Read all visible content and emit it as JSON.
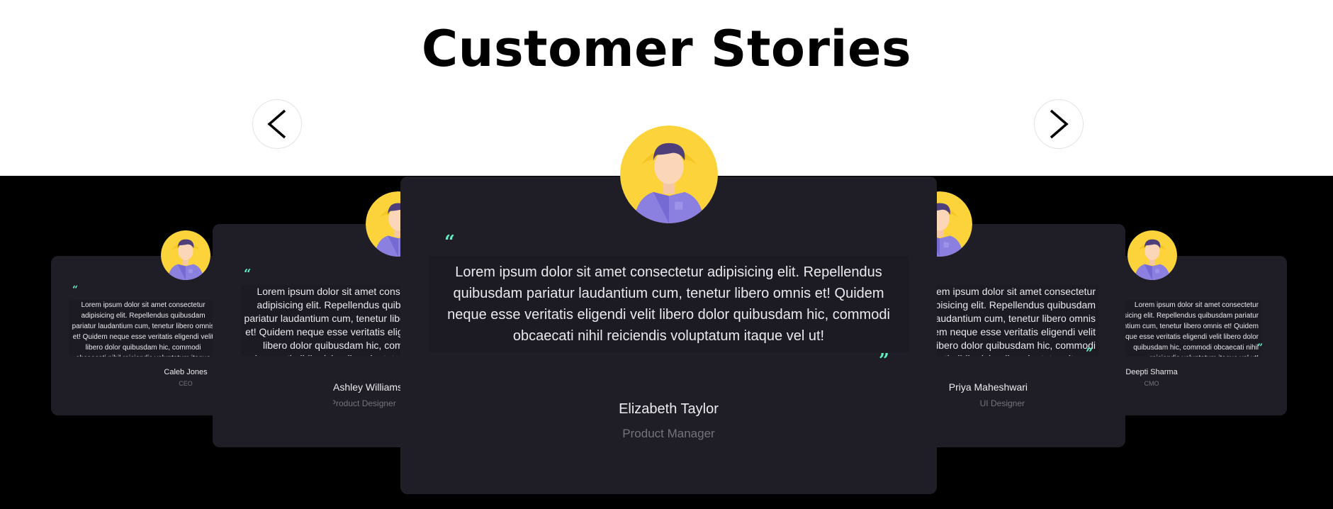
{
  "page": {
    "title": "Customer Stories"
  },
  "nav": {
    "prev_icon": "chevron-left-icon",
    "next_icon": "chevron-right-icon"
  },
  "colors": {
    "card_bg": "#1f1e26",
    "quote_accent": "#5ef0c0",
    "avatar_bg": "#fcd33a",
    "shirt": "#8b7fe0"
  },
  "testimonials": [
    {
      "text": "Lorem ipsum dolor sit amet consectetur adipisicing elit. Repellendus quibusdam pariatur laudantium cum, tenetur libero omnis et! Quidem neque esse veritatis eligendi velit libero dolor quibusdam hic, commodi obcaecati nihil reiciendis voluptatum itaque vel ut!",
      "name": "Caleb Jones",
      "role": "CEO"
    },
    {
      "text": "Lorem ipsum dolor sit amet consectetur adipisicing elit. Repellendus quibusdam pariatur laudantium cum, tenetur libero omnis et! Quidem neque esse veritatis eligendi velit libero dolor quibusdam hic, commodi obcaecati nihil reiciendis voluptatum itaque vel ut!",
      "name": "Ashley Williams",
      "role": "Product Designer"
    },
    {
      "text": "Lorem ipsum dolor sit amet consectetur adipisicing elit. Repellendus quibusdam pariatur laudantium cum, tenetur libero omnis et! Quidem neque esse veritatis eligendi velit libero dolor quibusdam hic, commodi obcaecati nihil reiciendis voluptatum itaque vel ut!",
      "name": "Elizabeth Taylor",
      "role": "Product Manager"
    },
    {
      "text": "Lorem ipsum dolor sit amet consectetur adipisicing elit. Repellendus quibusdam pariatur laudantium cum, tenetur libero omnis et! Quidem neque esse veritatis eligendi velit libero dolor quibusdam hic, commodi obcaecati nihil reiciendis voluptatum itaque vel ut!",
      "name": "Priya Maheshwari",
      "role": "UI Designer"
    },
    {
      "text": "Lorem ipsum dolor sit amet consectetur adipisicing elit. Repellendus quibusdam pariatur laudantium cum, tenetur libero omnis et! Quidem neque esse veritatis eligendi velit libero dolor quibusdam hic, commodi obcaecati nihil reiciendis voluptatum itaque vel ut!",
      "name": "Deepti Sharma",
      "role": "CMO"
    }
  ]
}
